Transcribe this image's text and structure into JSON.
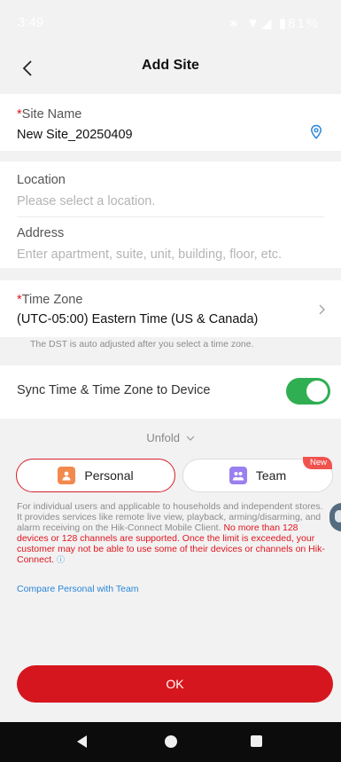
{
  "status_bar": {
    "time": "3:49",
    "icons": "∗ ▼◢ ▮81%"
  },
  "header": {
    "title": "Add Site"
  },
  "site_name": {
    "required_mark": "*",
    "label": "Site Name",
    "value": "New Site_20250409"
  },
  "location": {
    "label": "Location",
    "placeholder": "Please select a location."
  },
  "address": {
    "label": "Address",
    "placeholder": "Enter apartment, suite, unit, building, floor, etc."
  },
  "time_zone": {
    "required_mark": "*",
    "label": "Time Zone",
    "value": "(UTC-05:00) Eastern Time (US & Canada)",
    "note": "The DST is auto adjusted after you select a time zone."
  },
  "sync": {
    "label": "Sync Time & Time Zone to Device",
    "enabled": true
  },
  "unfold": {
    "label": "Unfold"
  },
  "site_type": {
    "personal_label": "Personal",
    "team_label": "Team",
    "new_badge": "New",
    "selected": "Personal",
    "description": "For individual users and applicable to households and independent stores. It provides services like remote live view, playback, arming/disarming, and alarm receiving on the Hik-Connect Mobile Client.",
    "warning": "No more than 128 devices or 128 channels are supported. Once the limit is exceeded, your customer may not be able to use some of their devices or channels on Hik-Connect.",
    "compare_link": "Compare Personal with Team"
  },
  "actions": {
    "ok_label": "OK"
  },
  "colors": {
    "accent": "#d6161f",
    "toggle_on": "#2fae52",
    "link": "#2a86d8"
  }
}
